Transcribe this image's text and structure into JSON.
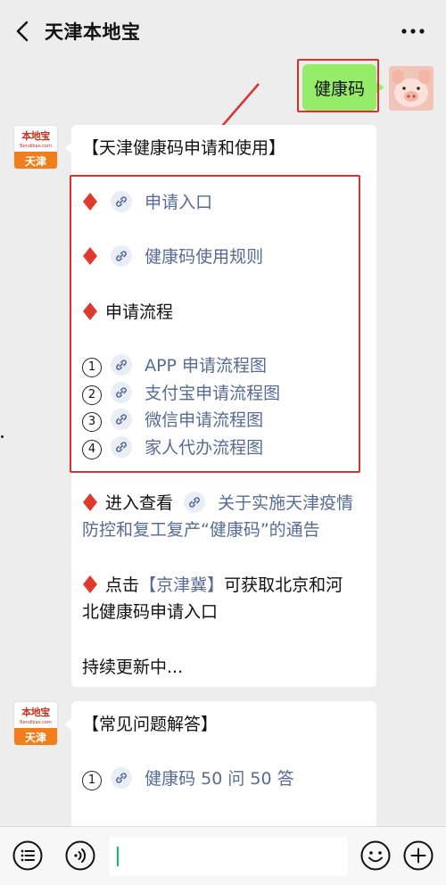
{
  "header": {
    "title": "天津本地宝",
    "back_icon": "chevron-left-icon",
    "more_icon": "more-dots-icon"
  },
  "outgoing": {
    "text": "健康码"
  },
  "brand_avatar": {
    "logo": "本地宝",
    "logo_sub": "Bendibao.com",
    "city": "天津"
  },
  "message1": {
    "title": "【天津健康码申请和使用】",
    "links_top": [
      "申请入口",
      "健康码使用规则"
    ],
    "process_heading": "申请流程",
    "process_items": [
      {
        "num": "1",
        "label": "APP 申请流程图"
      },
      {
        "num": "2",
        "label": "支付宝申请流程图"
      },
      {
        "num": "3",
        "label": "微信申请流程图"
      },
      {
        "num": "4",
        "label": "家人代办流程图"
      }
    ],
    "enter_prefix": "进入查看",
    "enter_link_line1": "关于实施天津疫情",
    "enter_link_line2": "防控和复工复产“健康码”的通告",
    "click_prefix": "点击",
    "click_link": "【京津冀】",
    "click_suffix": "可获取北京和河",
    "click_line2": "北健康码申请入口",
    "updating": "持续更新中..."
  },
  "message2": {
    "title": "【常见问题解答】",
    "items": [
      {
        "num": "1",
        "label": "健康码 50 问 50 答"
      }
    ]
  },
  "colors": {
    "accent_red": "#d9322c",
    "bubble_green": "#95ec69",
    "link_blue": "#576b95",
    "brand_orange": "#ef7e1b"
  },
  "bottom_bar": {
    "left_icon": "menu-list-icon",
    "voice_icon": "voice-icon",
    "emoji_icon": "emoji-icon",
    "plus_icon": "plus-icon"
  }
}
